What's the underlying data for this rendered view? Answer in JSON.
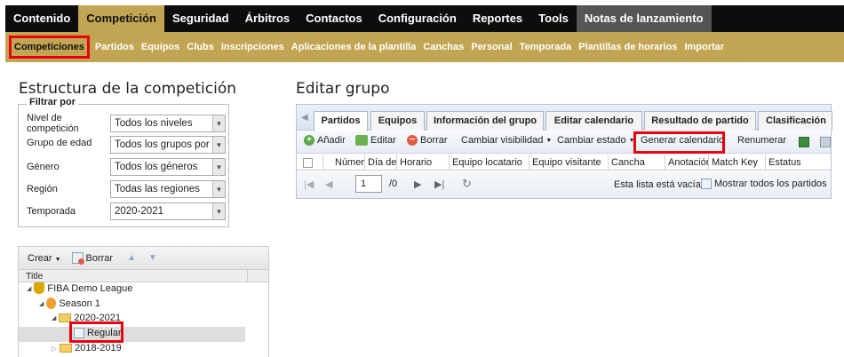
{
  "topnav": {
    "tabs": [
      {
        "label": "Contenido"
      },
      {
        "label": "Competición"
      },
      {
        "label": "Seguridad"
      },
      {
        "label": "Árbitros"
      },
      {
        "label": "Contactos"
      },
      {
        "label": "Configuración"
      },
      {
        "label": "Reportes"
      },
      {
        "label": "Tools"
      },
      {
        "label": "Notas de lanzamiento"
      }
    ]
  },
  "subnav": {
    "items": [
      {
        "label": "Competiciones"
      },
      {
        "label": "Partidos"
      },
      {
        "label": "Equipos"
      },
      {
        "label": "Clubs"
      },
      {
        "label": "Inscripciones"
      },
      {
        "label": "Aplicaciones de la plantilla"
      },
      {
        "label": "Canchas"
      },
      {
        "label": "Personal"
      },
      {
        "label": "Temporada"
      },
      {
        "label": "Plantillas de horarios"
      },
      {
        "label": "Importar"
      }
    ]
  },
  "left": {
    "title": "Estructura de la competición",
    "filter_legend": "Filtrar por",
    "filters": [
      {
        "label": "Nivel de competición",
        "value": "Todos los niveles"
      },
      {
        "label": "Grupo de edad",
        "value": "Todos los grupos por"
      },
      {
        "label": "Género",
        "value": "Todos los géneros"
      },
      {
        "label": "Región",
        "value": "Todas las regiones"
      },
      {
        "label": "Temporada",
        "value": "2020-2021"
      }
    ],
    "tree_toolbar": {
      "create": "Crear",
      "delete": "Borrar"
    },
    "tree_header": "Title",
    "tree": [
      {
        "label": "FIBA Demo League"
      },
      {
        "label": "Season 1"
      },
      {
        "label": "2020-2021"
      },
      {
        "label": "Regular"
      },
      {
        "label": "2018-2019"
      }
    ]
  },
  "right": {
    "title": "Editar grupo",
    "tabs": [
      {
        "label": "Partidos"
      },
      {
        "label": "Equipos"
      },
      {
        "label": "Información del grupo"
      },
      {
        "label": "Editar calendario"
      },
      {
        "label": "Resultado de partido"
      },
      {
        "label": "Clasificación"
      }
    ],
    "toolbar": {
      "add": "Añadir",
      "edit": "Editar",
      "delete": "Borrar",
      "visibility": "Cambiar visibilidad",
      "state": "Cambiar estado",
      "generate": "Generar calendario",
      "renumber": "Renumerar"
    },
    "columns": [
      {
        "label": "Número"
      },
      {
        "label": "Día de"
      },
      {
        "label": "Horario"
      },
      {
        "label": "Equipo locatario"
      },
      {
        "label": "Equipo visitante"
      },
      {
        "label": "Cancha"
      },
      {
        "label": "Anotación"
      },
      {
        "label": "Match Key"
      },
      {
        "label": "Estatus"
      }
    ],
    "pager": {
      "page": "1",
      "of": "/0",
      "empty": "Esta lista está vacía",
      "show_all": "Mostrar todos los partidos"
    }
  },
  "colors": {
    "gold": "#c2a552",
    "dark": "#0d0d0d",
    "highlight": "#e8000d"
  }
}
